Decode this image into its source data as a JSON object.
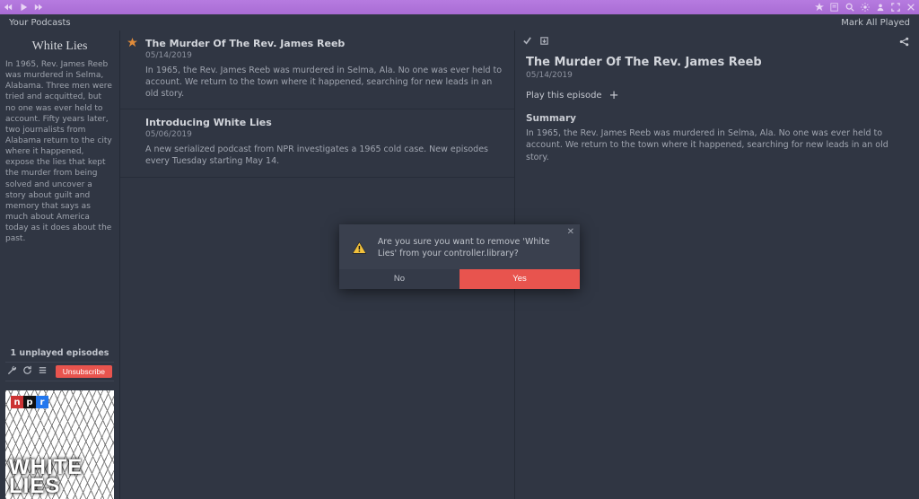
{
  "titlebar": {
    "icons_left": [
      "skip-back",
      "play",
      "skip-forward"
    ],
    "icons_right": [
      "star",
      "note",
      "search",
      "gear",
      "person",
      "expand",
      "close"
    ]
  },
  "header": {
    "left": "Your Podcasts",
    "right": "Mark All Played"
  },
  "sidebar": {
    "title": "White Lies",
    "description": "In 1965, Rev. James Reeb was murdered in Selma, Alabama. Three men were tried and acquitted, but no one was ever held to account. Fifty years later, two journalists from Alabama return to the city where it happened, expose the lies that kept the murder from being solved and uncover a story about guilt and memory that says as much about America today as it does about the past.",
    "unplayed": "1 unplayed episodes",
    "unsubscribe": "Unsubscribe",
    "cover": {
      "npr": [
        "n",
        "p",
        "r"
      ],
      "title_line1": "WHITE",
      "title_line2": "LIES"
    }
  },
  "episodes": [
    {
      "starred": true,
      "title": "The Murder Of The Rev. James Reeb",
      "date": "05/14/2019",
      "body": "In 1965, the Rev. James Reeb was murdered in Selma, Ala. No one was ever held to account. We return to the town where it happened, searching for new leads in an old story."
    },
    {
      "starred": false,
      "title": "Introducing White Lies",
      "date": "05/06/2019",
      "body": "A new serialized podcast from NPR investigates a 1965 cold case. New episodes every Tuesday starting May 14."
    }
  ],
  "detail": {
    "title": "The Murder Of The Rev. James Reeb",
    "date": "05/14/2019",
    "play_label": "Play this episode",
    "summary_heading": "Summary",
    "summary": "In 1965, the Rev. James Reeb was murdered in Selma, Ala. No one was ever held to account. We return to the town where it happened, searching for new leads in an old story."
  },
  "modal": {
    "message": "Are you sure you want to remove 'White Lies' from your controller.library?",
    "no": "No",
    "yes": "Yes"
  }
}
